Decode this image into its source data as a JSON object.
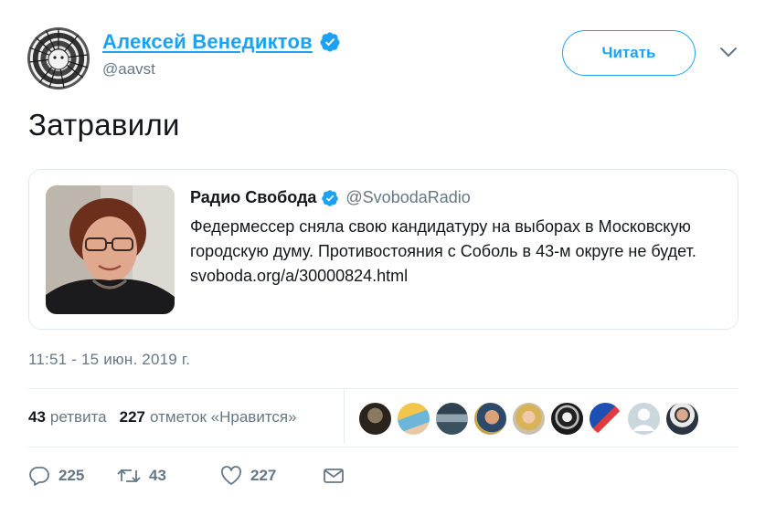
{
  "author": {
    "name": "Алексей Венедиктов",
    "handle": "@aavst",
    "verified": true
  },
  "follow_button_label": "Читать",
  "tweet_text": "Затравили",
  "quoted_tweet": {
    "author_name": "Радио Свобода",
    "author_handle": "@SvobodaRadio",
    "verified": true,
    "body": "Федермессер сняла свою кандидатуру на выборах в Московскую городскую думу. Противостояния с Соболь в 43-м округе не будет. svoboda.org/a/30000824.html"
  },
  "timestamp": "11:51 - 15 июн. 2019 г.",
  "stats": {
    "retweets_count": "43",
    "retweets_label": "ретвита",
    "likes_count": "227",
    "likes_label": "отметок «Нравится»"
  },
  "likers_count": 9,
  "actions": {
    "reply_count": "225",
    "retweet_count": "43",
    "like_count": "227"
  },
  "colors": {
    "accent": "#1da1f2",
    "text_primary": "#14171a",
    "text_secondary": "#657786",
    "border": "#e1e8ed"
  },
  "icons": [
    "verified-badge-icon",
    "chevron-down-icon",
    "reply-icon",
    "retweet-icon",
    "heart-icon",
    "envelope-icon"
  ]
}
